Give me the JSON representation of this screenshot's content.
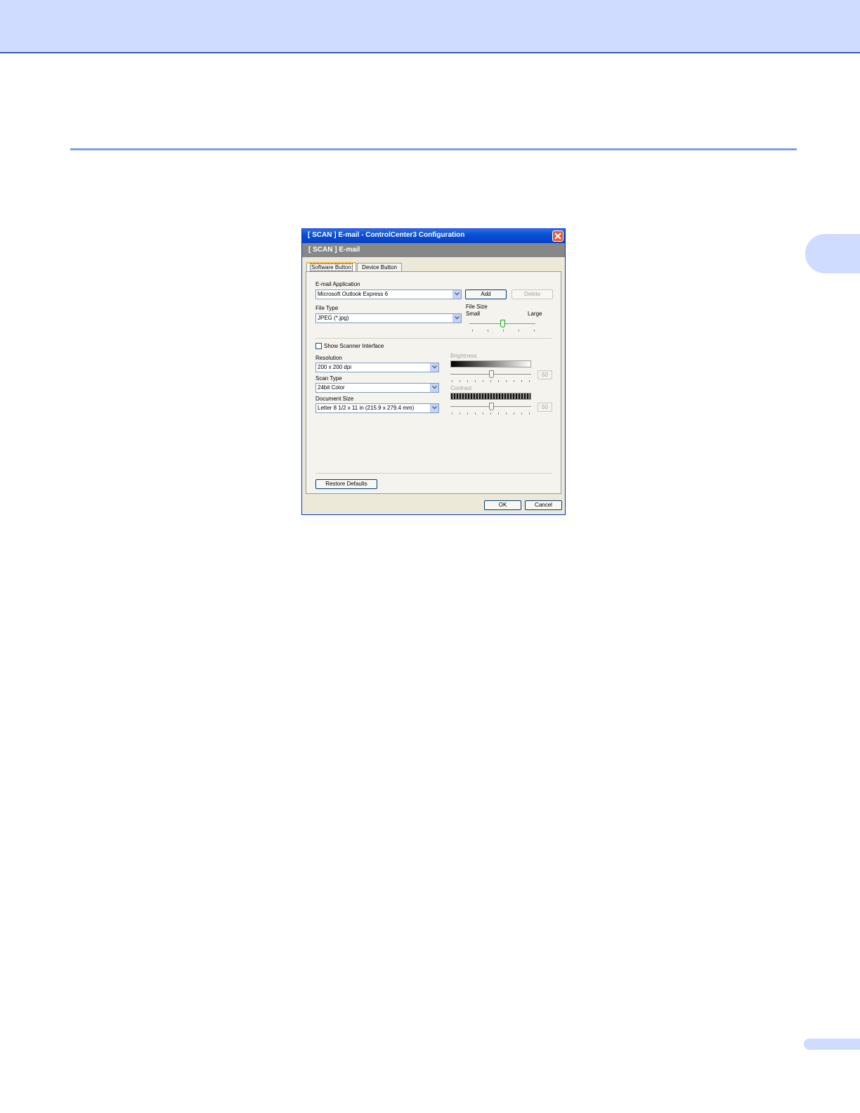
{
  "dialog": {
    "title": "[  SCAN  ]   E-mail - ControlCenter3 Configuration",
    "subheader": "[  SCAN  ]   E-mail",
    "tabs": [
      {
        "label": "Software Button"
      },
      {
        "label": "Device Button"
      }
    ],
    "email_application": {
      "label": "E-mail Application",
      "value": "Microsoft Outlook Express 6",
      "add_label": "Add",
      "delete_label": "Delete"
    },
    "file_type": {
      "label": "File Type",
      "value": "JPEG (*.jpg)"
    },
    "file_size": {
      "label": "File Size",
      "small_label": "Small",
      "large_label": "Large",
      "level_fraction": 0.5
    },
    "show_scanner_interface": {
      "label": "Show Scanner Interface",
      "checked": false
    },
    "resolution": {
      "label": "Resolution",
      "value": "200 x 200 dpi"
    },
    "scan_type": {
      "label": "Scan Type",
      "value": "24bit Color"
    },
    "document_size": {
      "label": "Document Size",
      "value": "Letter 8 1/2 x 11 in (215.9 x 279.4 mm)"
    },
    "brightness": {
      "label": "Brightness",
      "value": "50",
      "enabled": false
    },
    "contrast": {
      "label": "Contrast",
      "value": "50",
      "enabled": false
    },
    "restore_defaults_label": "Restore Defaults",
    "ok_label": "OK",
    "cancel_label": "Cancel"
  },
  "icons": {
    "close": "close-icon",
    "dropdown": "chevron-down-icon"
  },
  "colors": {
    "page_header": "#cfdcff",
    "rule": "#7f9df0",
    "titlebar": "#0a4fd6",
    "subheader": "#878787"
  }
}
